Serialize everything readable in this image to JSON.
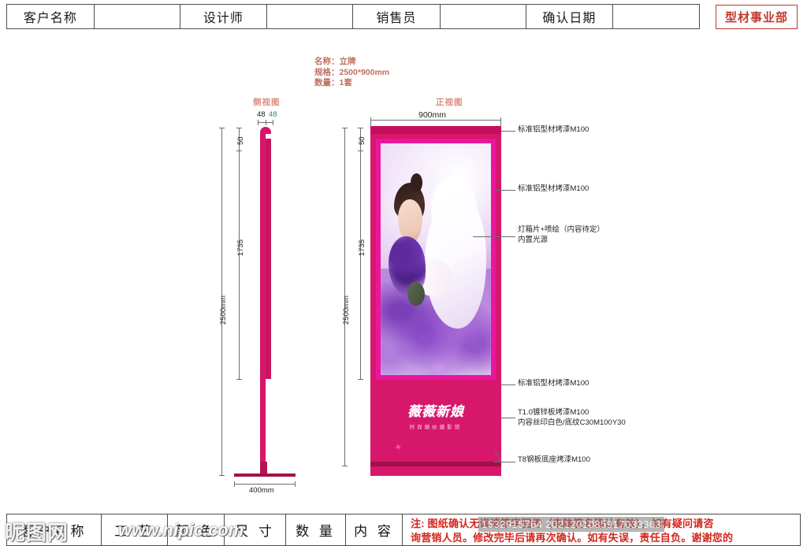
{
  "header": {
    "cells": [
      {
        "label": "客户名称",
        "type": "label"
      },
      {
        "label": "",
        "type": "blank"
      },
      {
        "label": "设计师",
        "type": "label"
      },
      {
        "label": "",
        "type": "blank"
      },
      {
        "label": "销售员",
        "type": "label"
      },
      {
        "label": "",
        "type": "blank"
      },
      {
        "label": "确认日期",
        "type": "label"
      },
      {
        "label": "",
        "type": "blank"
      }
    ],
    "badge": "型材事业部"
  },
  "info": {
    "name_line": "名称：立牌",
    "spec_line": "规格：2500*900mm",
    "qty_line": "数量：1套"
  },
  "views": {
    "side_title": "侧视图",
    "front_title": "正视图"
  },
  "dimensions": {
    "side_thickness_black": "48",
    "side_thickness_green": "48",
    "side_top": "50",
    "side_mid": "1735",
    "side_total": "2500mm",
    "base_width": "400mm",
    "front_width": "900mm",
    "front_top": "50",
    "front_mid": "1735",
    "front_total": "2500mm"
  },
  "annotations": [
    {
      "text": "标准铝型材烤漆M100"
    },
    {
      "text": "标准铝型材烤漆M100"
    },
    {
      "text": "灯箱片+喷绘（内容待定）"
    },
    {
      "text": "内置光源"
    },
    {
      "text": "标准铝型材烤漆M100"
    },
    {
      "text": "T1.0镀锌板烤漆M100"
    },
    {
      "text": "内容丝印白色/底纹C30M100Y30"
    },
    {
      "text": "T8钢板底座烤漆M100"
    }
  ],
  "poster": {
    "logo_main": "薇薇新娘",
    "logo_sub": "时尚婚纱摄影馆",
    "logo_mark": "✦"
  },
  "bottom": {
    "cells": [
      "客户名称",
      "工 艺",
      "颜 色",
      "尺 寸",
      "数 量",
      "内 容"
    ],
    "note_line1": "注: 图纸确认无误请签字回传（电脑签名确认有效），如有疑问请咨",
    "note_line2": "询营销人员。修改完毕后请再次确认。如有失误，责任自负。谢谢您的"
  },
  "watermark": {
    "logo": "昵图网",
    "url": "www.nipic.com",
    "numbers": "1532915764 2021201085917033363"
  },
  "colors": {
    "magenta": "#d6176b",
    "magenta_dark": "#a01047",
    "lightbox": "#e8179c",
    "badge_red": "#c0392b",
    "note_red": "#d4251c",
    "info_text": "#c0705f",
    "view_title": "#d98b80",
    "dim_green": "#2e8b57"
  }
}
